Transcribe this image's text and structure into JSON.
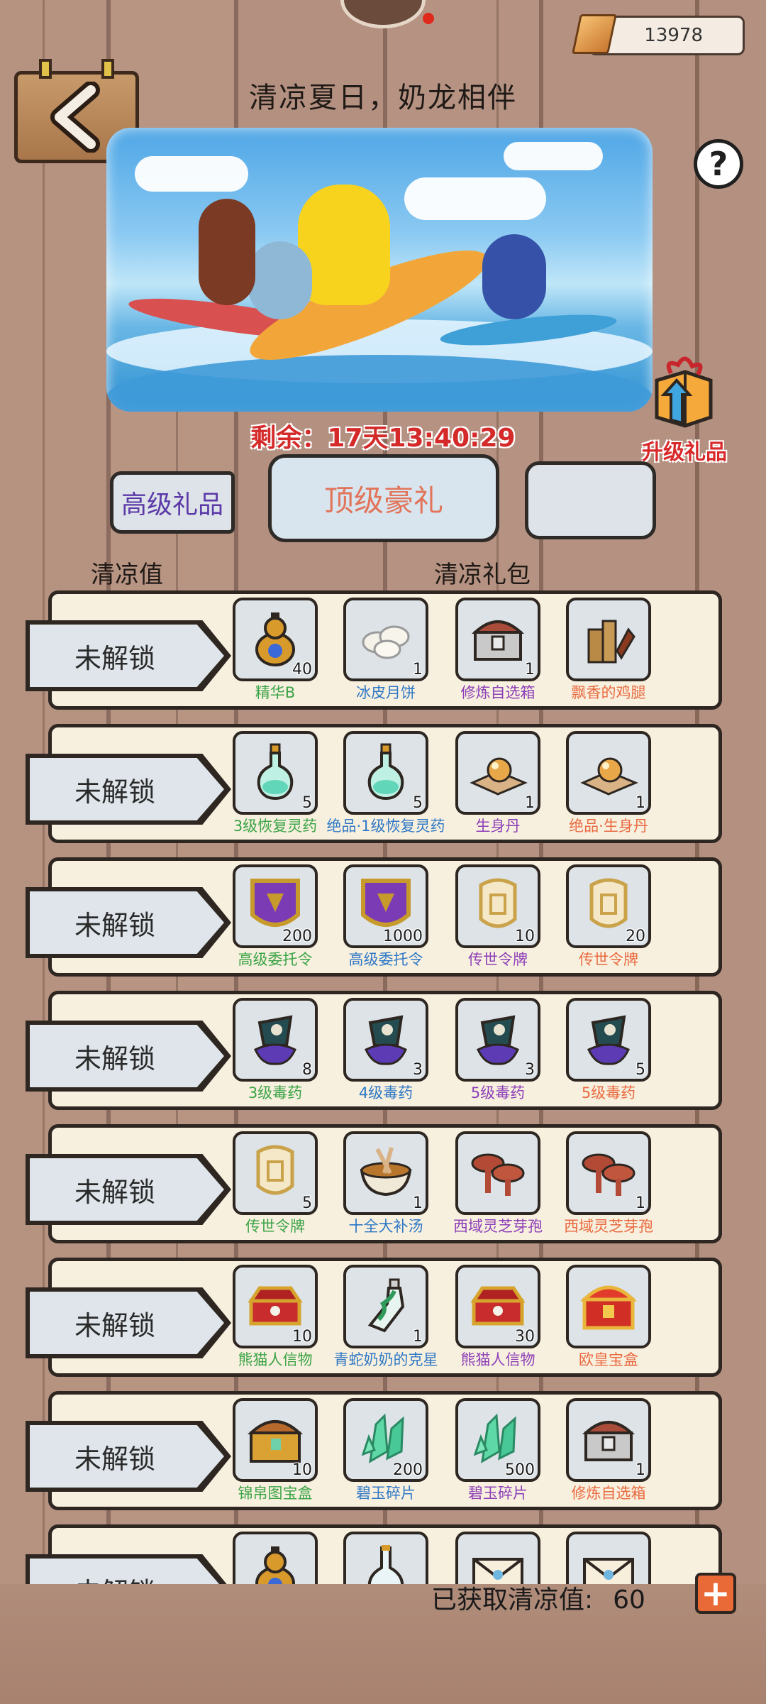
{
  "header": {
    "gold_amount": "13978",
    "title": "清凉夏日，奶龙相伴",
    "help_label": "?"
  },
  "event": {
    "timer_label": "剩余：17天13:40:29",
    "upgrade_gift_label": "升级礼品"
  },
  "tabs": [
    {
      "label": "高级礼品"
    },
    {
      "label": "顶级豪礼"
    },
    {
      "label": ""
    }
  ],
  "columns": {
    "left": "清凉值",
    "right": "清凉礼包"
  },
  "rows": [
    {
      "lock_label": "未解锁",
      "items": [
        {
          "name": "精华B",
          "count": "40",
          "quality": "green",
          "icon": "gourd-icon"
        },
        {
          "name": "冰皮月饼",
          "count": "1",
          "quality": "blue",
          "icon": "mooncake-icon"
        },
        {
          "name": "修炼自选箱",
          "count": "1",
          "quality": "purple",
          "icon": "chest-icon"
        },
        {
          "name": "飘香的鸡腿",
          "count": "",
          "quality": "orange",
          "icon": "chicken-leg-icon"
        }
      ]
    },
    {
      "lock_label": "未解锁",
      "items": [
        {
          "name": "3级恢复灵药",
          "count": "5",
          "quality": "green",
          "icon": "potion-icon"
        },
        {
          "name": "绝品·1级恢复灵药",
          "count": "5",
          "quality": "blue",
          "icon": "potion-icon"
        },
        {
          "name": "生身丹",
          "count": "1",
          "quality": "purple",
          "icon": "pill-icon"
        },
        {
          "name": "绝品·生身丹",
          "count": "1",
          "quality": "orange",
          "icon": "pill-icon"
        }
      ]
    },
    {
      "lock_label": "未解锁",
      "items": [
        {
          "name": "高级委托令",
          "count": "200",
          "quality": "green",
          "icon": "token-shield-icon"
        },
        {
          "name": "高级委托令",
          "count": "1000",
          "quality": "blue",
          "icon": "token-shield-icon"
        },
        {
          "name": "传世令牌",
          "count": "10",
          "quality": "purple",
          "icon": "plaque-icon"
        },
        {
          "name": "传世令牌",
          "count": "20",
          "quality": "orange",
          "icon": "plaque-icon"
        }
      ]
    },
    {
      "lock_label": "未解锁",
      "items": [
        {
          "name": "3级毒药",
          "count": "8",
          "quality": "green",
          "icon": "poison-bag-icon"
        },
        {
          "name": "4级毒药",
          "count": "3",
          "quality": "blue",
          "icon": "poison-bag-icon"
        },
        {
          "name": "5级毒药",
          "count": "3",
          "quality": "purple",
          "icon": "poison-bag-icon"
        },
        {
          "name": "5级毒药",
          "count": "5",
          "quality": "orange",
          "icon": "poison-bag-icon"
        }
      ]
    },
    {
      "lock_label": "未解锁",
      "items": [
        {
          "name": "传世令牌",
          "count": "5",
          "quality": "green",
          "icon": "plaque-icon"
        },
        {
          "name": "十全大补汤",
          "count": "1",
          "quality": "blue",
          "icon": "soup-bowl-icon"
        },
        {
          "name": "西域灵芝芽孢",
          "count": "",
          "quality": "purple",
          "icon": "mushroom-icon"
        },
        {
          "name": "西域灵芝芽孢",
          "count": "1",
          "quality": "orange",
          "icon": "mushroom-icon"
        }
      ]
    },
    {
      "lock_label": "未解锁",
      "items": [
        {
          "name": "熊猫人信物",
          "count": "10",
          "quality": "green",
          "icon": "panda-chest-icon"
        },
        {
          "name": "青蛇奶奶的克星",
          "count": "1",
          "quality": "blue",
          "icon": "snake-bottle-icon"
        },
        {
          "name": "熊猫人信物",
          "count": "30",
          "quality": "purple",
          "icon": "panda-chest-icon"
        },
        {
          "name": "欧皇宝盒",
          "count": "",
          "quality": "orange",
          "icon": "red-chest-icon"
        }
      ]
    },
    {
      "lock_label": "未解锁",
      "items": [
        {
          "name": "锦帛图宝盒",
          "count": "10",
          "quality": "green",
          "icon": "gold-chest-icon"
        },
        {
          "name": "碧玉碎片",
          "count": "200",
          "quality": "blue",
          "icon": "jade-shard-icon"
        },
        {
          "name": "碧玉碎片",
          "count": "500",
          "quality": "purple",
          "icon": "jade-shard-icon"
        },
        {
          "name": "修炼自选箱",
          "count": "1",
          "quality": "orange",
          "icon": "chest-icon"
        }
      ]
    },
    {
      "lock_label": "未解锁",
      "items": [
        {
          "name": "",
          "count": "",
          "quality": "green",
          "icon": "gourd-icon"
        },
        {
          "name": "",
          "count": "",
          "quality": "blue",
          "icon": "bottle-icon"
        },
        {
          "name": "",
          "count": "",
          "quality": "purple",
          "icon": "envelope-icon"
        },
        {
          "name": "",
          "count": "",
          "quality": "orange",
          "icon": "envelope-icon"
        }
      ]
    }
  ],
  "footer": {
    "earned_label": "已获取清凉值:",
    "earned_value": "60",
    "plus_label": "+"
  }
}
